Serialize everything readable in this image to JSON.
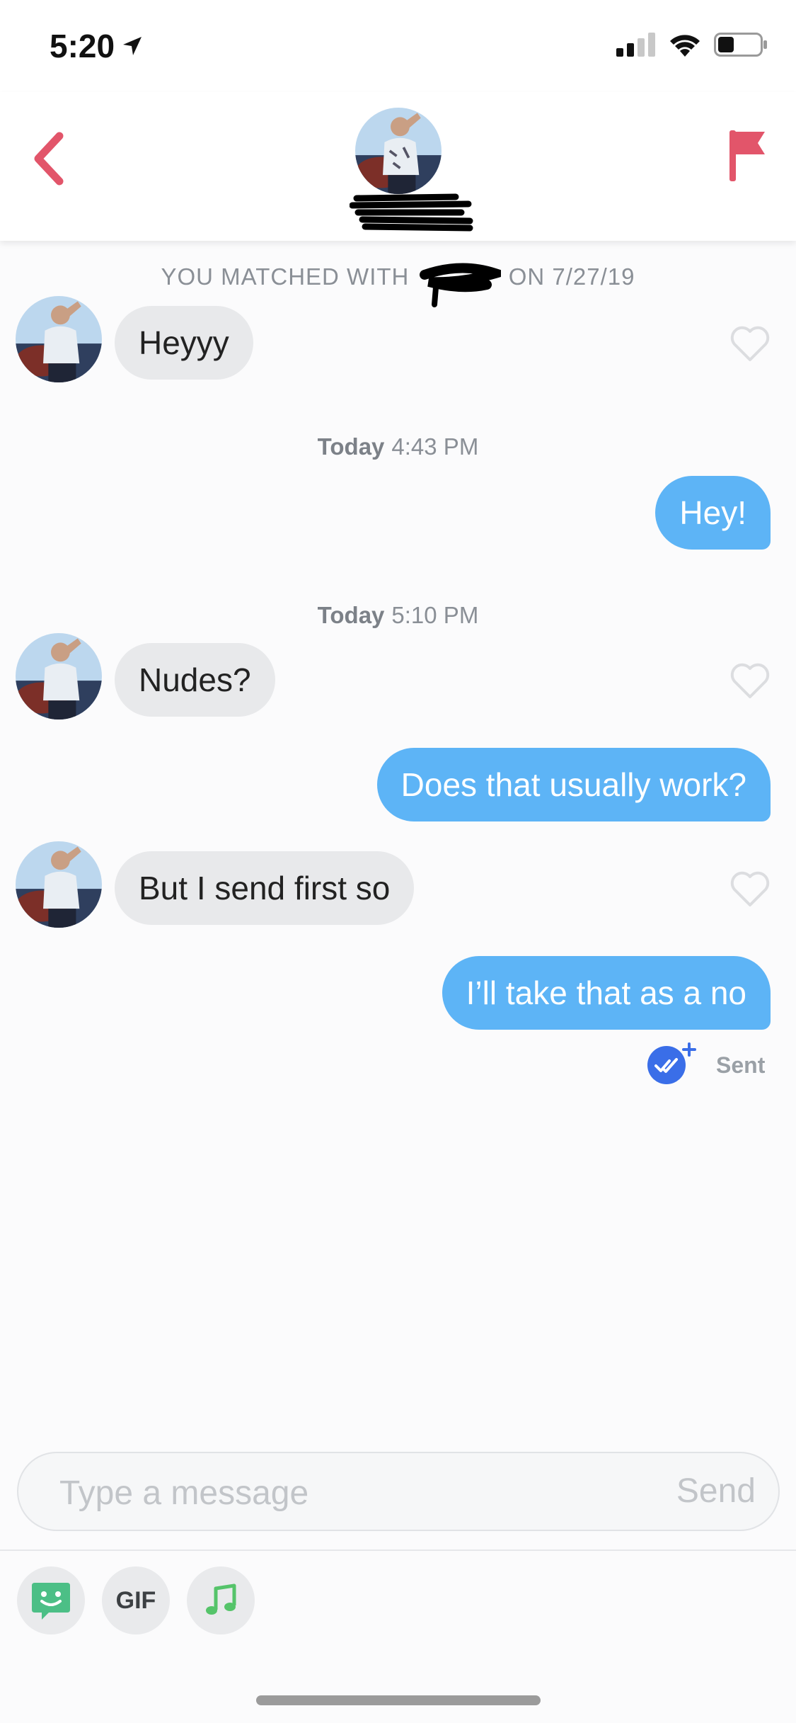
{
  "status_bar": {
    "time": "5:20",
    "icons": [
      "location-arrow-icon",
      "cellular-signal-icon",
      "wifi-icon",
      "battery-icon"
    ]
  },
  "header": {
    "back_icon": "chevron-left-icon",
    "report_icon": "flag-icon",
    "accent_color": "#e2556a"
  },
  "chat": {
    "match_banner": {
      "prefix": "YOU MATCHED WITH",
      "suffix": "ON 7/27/19"
    },
    "timestamps": [
      {
        "day": "Today",
        "time": "4:43 PM"
      },
      {
        "day": "Today",
        "time": "5:10 PM"
      }
    ],
    "messages": [
      {
        "direction": "incoming",
        "text": "Heyyy"
      },
      {
        "direction": "outgoing",
        "text": "Hey!"
      },
      {
        "direction": "incoming",
        "text": "Nudes?"
      },
      {
        "direction": "outgoing",
        "text": "Does that usually work?"
      },
      {
        "direction": "incoming",
        "text": "But I send first so"
      },
      {
        "direction": "outgoing",
        "text": "I’ll take that as a no"
      }
    ],
    "receipt": {
      "label": "Sent"
    },
    "colors": {
      "incoming_bubble": "#e8e9eb",
      "outgoing_bubble": "#5db4f6",
      "receipt_badge": "#3a6ee8"
    }
  },
  "composer": {
    "placeholder": "Type a message",
    "send_label": "Send",
    "tools": [
      {
        "name": "sticker",
        "icon": "smiley-sticker-icon"
      },
      {
        "name": "gif",
        "label": "GIF"
      },
      {
        "name": "music",
        "icon": "music-note-icon"
      }
    ]
  }
}
